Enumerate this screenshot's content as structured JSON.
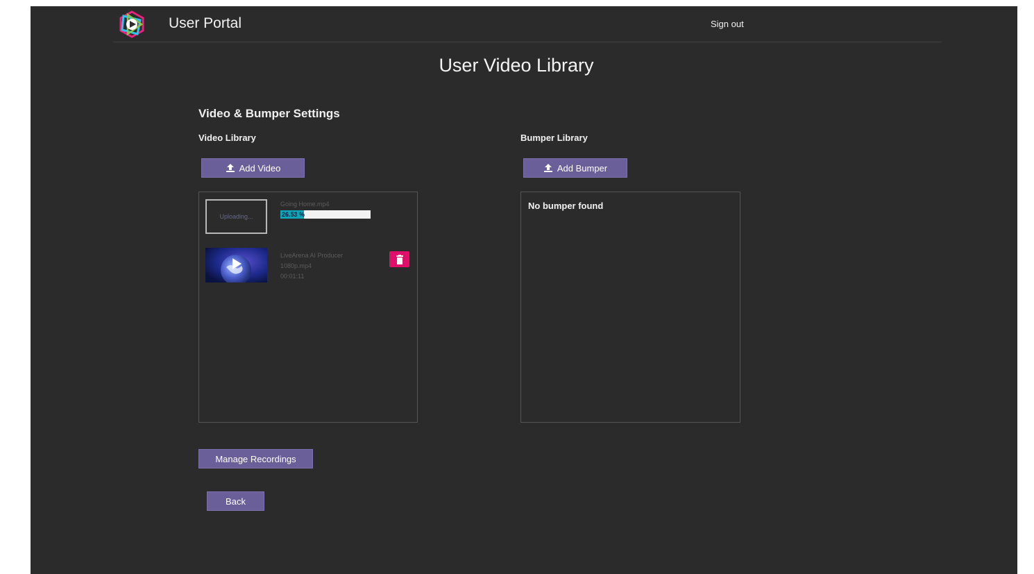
{
  "header": {
    "portal_title": "User Portal",
    "signout_label": "Sign out"
  },
  "page": {
    "title": "User Video Library",
    "section_title": "Video & Bumper Settings"
  },
  "video_library": {
    "label": "Video Library",
    "add_button": "Add Video",
    "uploading_item": {
      "thumb_text": "Uploading...",
      "file_name": "Going Home.mp4",
      "progress_percent": 26.53,
      "progress_text": "26.53 %"
    },
    "items": [
      {
        "title": "LiveArena AI Producer",
        "file": "1080p.mp4",
        "duration": "00:01:11"
      }
    ]
  },
  "bumper_library": {
    "label": "Bumper Library",
    "add_button": "Add Bumper",
    "empty_message": "No bumper found"
  },
  "actions": {
    "manage_recordings": "Manage Recordings",
    "back": "Back"
  },
  "colors": {
    "background": "#2b2b2b",
    "button": "#6b5f9a",
    "progress": "#0ea5b8",
    "delete": "#e0106a"
  },
  "icons": {
    "logo": "play-logo-icon",
    "upload": "upload-icon",
    "delete": "trash-icon",
    "video_play": "play-icon"
  }
}
